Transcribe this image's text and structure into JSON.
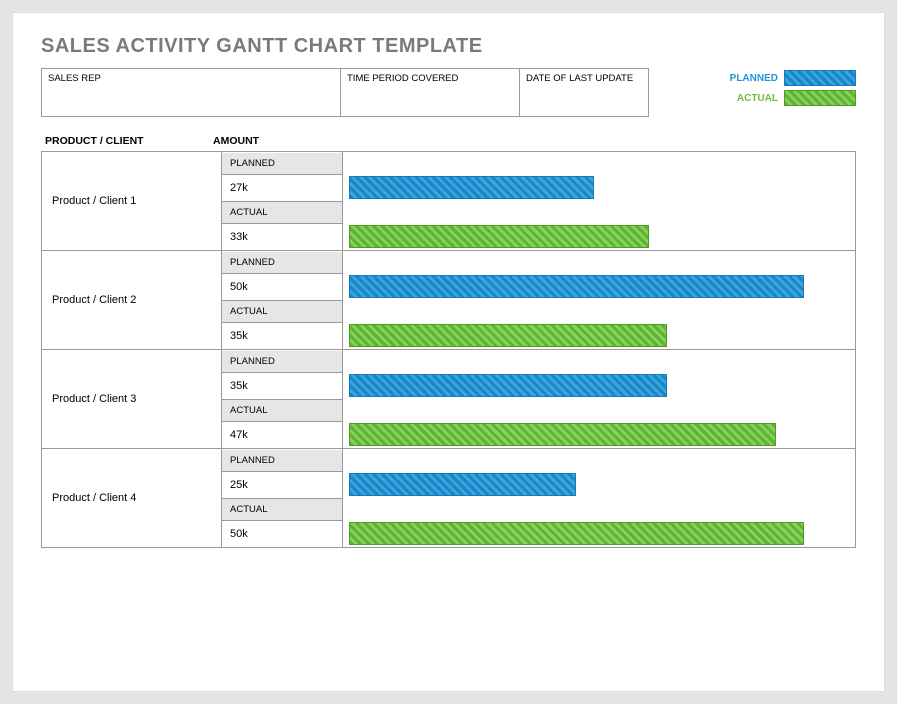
{
  "title": "SALES ACTIVITY GANTT CHART TEMPLATE",
  "meta": {
    "sales_rep_label": "SALES REP",
    "time_period_label": "TIME PERIOD COVERED",
    "last_update_label": "DATE OF LAST UPDATE"
  },
  "legend": {
    "planned": "PLANNED",
    "actual": "ACTUAL"
  },
  "columns": {
    "product": "PRODUCT / CLIENT",
    "amount": "AMOUNT"
  },
  "row_labels": {
    "planned": "PLANNED",
    "actual": "ACTUAL"
  },
  "rows": [
    {
      "name": "Product / Client 1",
      "planned": "27k",
      "actual": "33k"
    },
    {
      "name": "Product / Client 2",
      "planned": "50k",
      "actual": "35k"
    },
    {
      "name": "Product / Client 3",
      "planned": "35k",
      "actual": "47k"
    },
    {
      "name": "Product / Client 4",
      "planned": "25k",
      "actual": "50k"
    }
  ],
  "chart_data": {
    "type": "bar",
    "title": "SALES ACTIVITY GANTT CHART TEMPLATE",
    "xlabel": "",
    "ylabel": "AMOUNT",
    "categories": [
      "Product / Client 1",
      "Product / Client 2",
      "Product / Client 3",
      "Product / Client 4"
    ],
    "series": [
      {
        "name": "PLANNED",
        "values": [
          27,
          50,
          35,
          25
        ]
      },
      {
        "name": "ACTUAL",
        "values": [
          33,
          35,
          47,
          50
        ]
      }
    ],
    "unit": "k",
    "xlim": [
      0,
      55
    ]
  }
}
